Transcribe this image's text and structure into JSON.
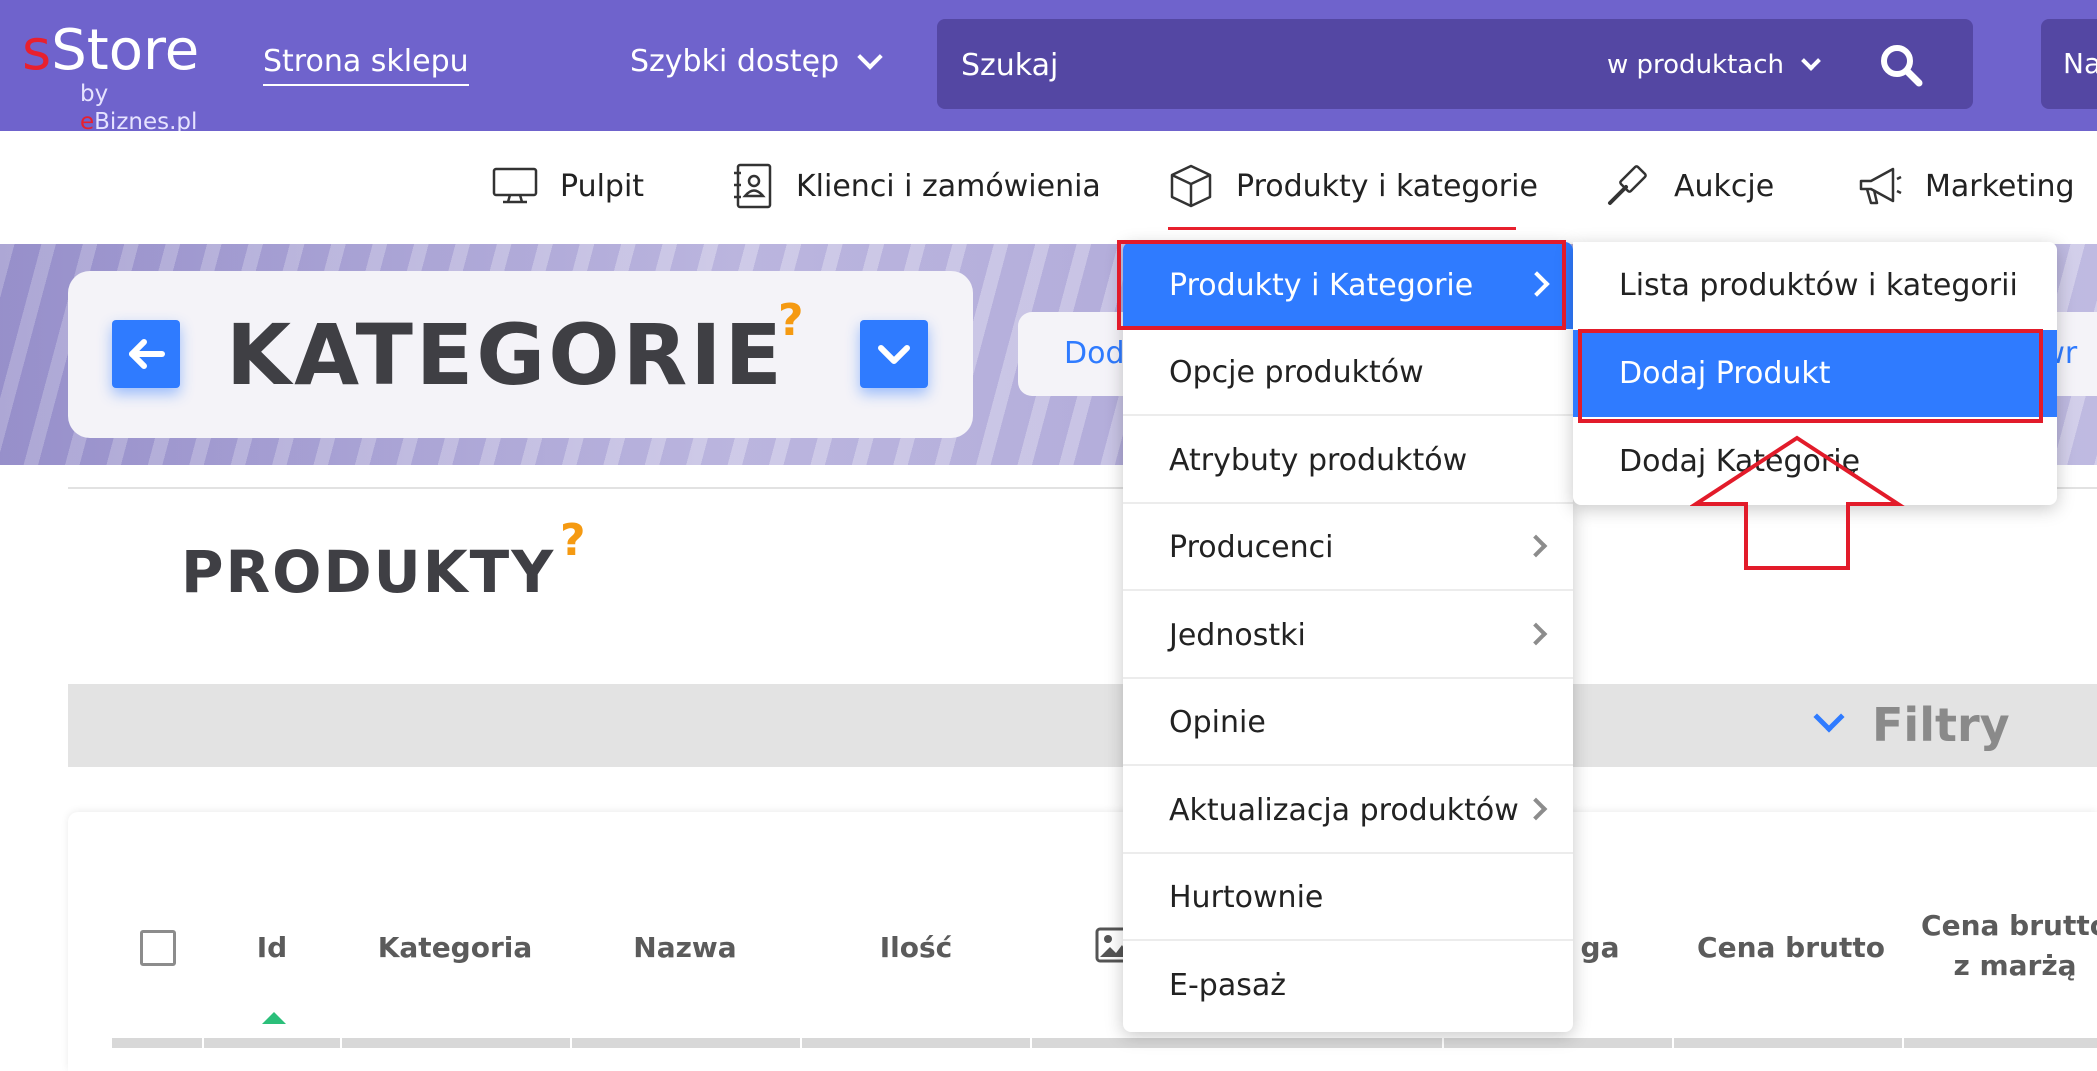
{
  "brand": {
    "logo_s": "s",
    "logo_rest": "Store",
    "sub_by": "by ",
    "sub_e": "e",
    "sub_rest": "Biznes.pl"
  },
  "topbar": {
    "store_link": "Strona sklepu",
    "quick_access": "Szybki dostęp",
    "search_placeholder": "Szukaj",
    "search_scope": "w produktach",
    "right_cut": "Na"
  },
  "mainnav": {
    "items": [
      {
        "label": "Pulpit",
        "icon": "monitor-icon"
      },
      {
        "label": "Klienci i zamówienia",
        "icon": "address-book-icon"
      },
      {
        "label": "Produkty i kategorie",
        "icon": "box-icon"
      },
      {
        "label": "Aukcje",
        "icon": "gavel-icon"
      },
      {
        "label": "Marketing",
        "icon": "megaphone-icon"
      }
    ],
    "active_index": 2
  },
  "hero": {
    "title": "KATEGORIE",
    "help": "?",
    "pill_left": "Dod",
    "pill_right": "owr"
  },
  "section": {
    "title": "PRODUKTY",
    "help": "?"
  },
  "filters": {
    "label": "Filtry"
  },
  "table": {
    "columns": [
      "Id",
      "Kategoria",
      "Nazwa",
      "Ilość",
      "ga",
      "Cena brutto",
      "Cena brutto\nz marżą"
    ]
  },
  "menu_level1": {
    "items": [
      {
        "label": "Produkty i Kategorie",
        "has_sub": true,
        "active": true
      },
      {
        "label": "Opcje produktów",
        "has_sub": false
      },
      {
        "label": "Atrybuty produktów",
        "has_sub": false
      },
      {
        "label": "Producenci",
        "has_sub": true
      },
      {
        "label": "Jednostki",
        "has_sub": true
      },
      {
        "label": "Opinie",
        "has_sub": false
      },
      {
        "label": "Aktualizacja produktów",
        "has_sub": true
      },
      {
        "label": "Hurtownie",
        "has_sub": false
      },
      {
        "label": "E-pasaż",
        "has_sub": false
      }
    ]
  },
  "menu_level2": {
    "items": [
      {
        "label": "Lista produktów i kategorii"
      },
      {
        "label": "Dodaj Produkt",
        "active": true
      },
      {
        "label": "Dodaj Kategorię"
      }
    ]
  },
  "colors": {
    "topbar": "#6f63cc",
    "accent": "#2f7bff",
    "help": "#f59a12",
    "highlight": "#e21b2a"
  }
}
